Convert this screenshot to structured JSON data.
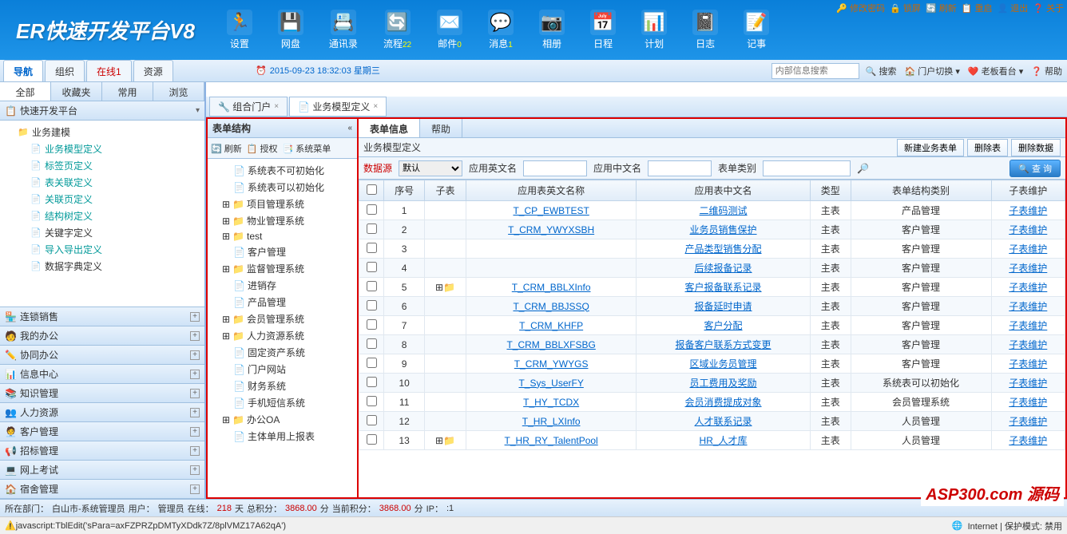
{
  "logo": "ER快速开发平台V8",
  "top_actions": [
    {
      "icon": "🔑",
      "label": "修改密码"
    },
    {
      "icon": "🔒",
      "label": "锁屏"
    },
    {
      "icon": "🔄",
      "label": "刷新"
    },
    {
      "icon": "📋",
      "label": "重启"
    },
    {
      "icon": "👤",
      "label": "退出"
    },
    {
      "icon": "❓",
      "label": "关于"
    }
  ],
  "toolbar": [
    {
      "icon": "🏃",
      "label": "设置",
      "count": ""
    },
    {
      "icon": "💾",
      "label": "网盘",
      "count": ""
    },
    {
      "icon": "📇",
      "label": "通讯录",
      "count": ""
    },
    {
      "icon": "🔄",
      "label": "流程",
      "count": "22"
    },
    {
      "icon": "✉️",
      "label": "邮件",
      "count": "0"
    },
    {
      "icon": "💬",
      "label": "消息",
      "count": "1"
    },
    {
      "icon": "📷",
      "label": "相册",
      "count": ""
    },
    {
      "icon": "📅",
      "label": "日程",
      "count": ""
    },
    {
      "icon": "📊",
      "label": "计划",
      "count": ""
    },
    {
      "icon": "📓",
      "label": "日志",
      "count": ""
    },
    {
      "icon": "📝",
      "label": "记事",
      "count": ""
    }
  ],
  "nav_tabs": [
    {
      "label": "导航",
      "active": true
    },
    {
      "label": "组织"
    },
    {
      "label": "在线1",
      "red": true
    },
    {
      "label": "资源"
    }
  ],
  "clock": "2015-09-23 18:32:03 星期三",
  "search_placeholder": "内部信息搜索",
  "sub_btns": [
    {
      "icon": "🔍",
      "label": "搜索"
    },
    {
      "icon": "🏠",
      "label": "门户切换",
      "dd": true
    },
    {
      "icon": "❤️",
      "label": "老板看台",
      "dd": true
    },
    {
      "icon": "❓",
      "label": "帮助"
    }
  ],
  "side_tabs": [
    "全部",
    "收藏夹",
    "常用",
    "浏览"
  ],
  "side_header": "快速开发平台",
  "tree": [
    {
      "d": 0,
      "ico": "📁",
      "label": "业务建模",
      "exp": true
    },
    {
      "d": 1,
      "ico": "📄",
      "label": "业务模型定义",
      "teal": true
    },
    {
      "d": 1,
      "ico": "📄",
      "label": "标签页定义",
      "teal": true
    },
    {
      "d": 1,
      "ico": "📄",
      "label": "表关联定义",
      "teal": true
    },
    {
      "d": 1,
      "ico": "📄",
      "label": "关联页定义",
      "teal": true
    },
    {
      "d": 1,
      "ico": "📄",
      "label": "结构树定义",
      "teal": true
    },
    {
      "d": 1,
      "ico": "📄",
      "label": "关键字定义"
    },
    {
      "d": 1,
      "ico": "📄",
      "label": "导入导出定义",
      "teal": true
    },
    {
      "d": 1,
      "ico": "📄",
      "label": "数据字典定义"
    }
  ],
  "accordion": [
    {
      "icon": "🏪",
      "label": "连锁销售"
    },
    {
      "icon": "🧑",
      "label": "我的办公"
    },
    {
      "icon": "✏️",
      "label": "协同办公"
    },
    {
      "icon": "📊",
      "label": "信息中心"
    },
    {
      "icon": "📚",
      "label": "知识管理"
    },
    {
      "icon": "👥",
      "label": "人力资源"
    },
    {
      "icon": "🧑‍💼",
      "label": "客户管理"
    },
    {
      "icon": "📢",
      "label": "招标管理"
    },
    {
      "icon": "💻",
      "label": "网上考试"
    },
    {
      "icon": "🏠",
      "label": "宿舍管理"
    }
  ],
  "content_tabs": [
    {
      "icon": "🔧",
      "label": "组合门户"
    },
    {
      "icon": "📄",
      "label": "业务模型定义",
      "active": true
    }
  ],
  "tree_panel": {
    "title": "表单结构",
    "toolbar": [
      {
        "icon": "🔄",
        "label": "刷新"
      },
      {
        "icon": "📋",
        "label": "授权"
      },
      {
        "icon": "📑",
        "label": "系统菜单"
      }
    ],
    "nodes": [
      {
        "d": 1,
        "ico": "📄",
        "label": "系统表不可初始化"
      },
      {
        "d": 1,
        "ico": "📄",
        "label": "系统表可以初始化"
      },
      {
        "d": 0,
        "ico": "📁",
        "label": "项目管理系统"
      },
      {
        "d": 0,
        "ico": "📁",
        "label": "物业管理系统"
      },
      {
        "d": 0,
        "ico": "📁",
        "label": "test"
      },
      {
        "d": 1,
        "ico": "📄",
        "label": "客户管理"
      },
      {
        "d": 0,
        "ico": "📁",
        "label": "监督管理系统"
      },
      {
        "d": 1,
        "ico": "📄",
        "label": "进销存"
      },
      {
        "d": 1,
        "ico": "📄",
        "label": "产品管理"
      },
      {
        "d": 0,
        "ico": "📁",
        "label": "会员管理系统"
      },
      {
        "d": 0,
        "ico": "📁",
        "label": "人力资源系统"
      },
      {
        "d": 1,
        "ico": "📄",
        "label": "固定资产系统"
      },
      {
        "d": 1,
        "ico": "📄",
        "label": "门户网站"
      },
      {
        "d": 1,
        "ico": "📄",
        "label": "财务系统"
      },
      {
        "d": 1,
        "ico": "📄",
        "label": "手机短信系统"
      },
      {
        "d": 0,
        "ico": "📁",
        "label": "办公OA"
      },
      {
        "d": 1,
        "ico": "📄",
        "label": "主体单用上报表"
      }
    ]
  },
  "data_panel": {
    "tabs": [
      "表单信息",
      "帮助"
    ],
    "title": "业务模型定义",
    "btns": [
      "新建业务表单",
      "删除表",
      "删除数据"
    ],
    "filter": {
      "ds_label": "数据源",
      "ds_value": "默认",
      "en_label": "应用英文名",
      "cn_label": "应用中文名",
      "type_label": "表单类别",
      "search": "查 询"
    },
    "cols": [
      "",
      "序号",
      "子表",
      "应用表英文名称",
      "应用表中文名",
      "类型",
      "表单结构类别",
      "子表维护"
    ],
    "rows": [
      {
        "n": 1,
        "sub": "",
        "en": "T_CP_EWBTEST",
        "cn": "二维码测试",
        "type": "主表",
        "cat": "产品管理",
        "m": "子表维护"
      },
      {
        "n": 2,
        "sub": "",
        "en": "T_CRM_YWYXSBH",
        "cn": "业务员销售保护",
        "type": "主表",
        "cat": "客户管理",
        "m": "子表维护"
      },
      {
        "n": 3,
        "sub": "",
        "en": "",
        "cn": "产品类型销售分配",
        "type": "主表",
        "cat": "客户管理",
        "m": "子表维护"
      },
      {
        "n": 4,
        "sub": "",
        "en": "",
        "cn": "后续报备记录",
        "type": "主表",
        "cat": "客户管理",
        "m": "子表维护"
      },
      {
        "n": 5,
        "sub": "⊞📁",
        "en": "T_CRM_BBLXInfo",
        "cn": "客户报备联系记录",
        "type": "主表",
        "cat": "客户管理",
        "m": "子表维护"
      },
      {
        "n": 6,
        "sub": "",
        "en": "T_CRM_BBJSSQ",
        "cn": "报备延时申请",
        "type": "主表",
        "cat": "客户管理",
        "m": "子表维护"
      },
      {
        "n": 7,
        "sub": "",
        "en": "T_CRM_KHFP",
        "cn": "客户分配",
        "type": "主表",
        "cat": "客户管理",
        "m": "子表维护"
      },
      {
        "n": 8,
        "sub": "",
        "en": "T_CRM_BBLXFSBG",
        "cn": "报备客户联系方式变更",
        "type": "主表",
        "cat": "客户管理",
        "m": "子表维护"
      },
      {
        "n": 9,
        "sub": "",
        "en": "T_CRM_YWYGS",
        "cn": "区域业务员管理",
        "type": "主表",
        "cat": "客户管理",
        "m": "子表维护"
      },
      {
        "n": 10,
        "sub": "",
        "en": "T_Sys_UserFY",
        "cn": "员工费用及奖励",
        "type": "主表",
        "cat": "系统表可以初始化",
        "m": "子表维护"
      },
      {
        "n": 11,
        "sub": "",
        "en": "T_HY_TCDX",
        "cn": "会员消费提成对象",
        "type": "主表",
        "cat": "会员管理系统",
        "m": "子表维护"
      },
      {
        "n": 12,
        "sub": "",
        "en": "T_HR_LXInfo",
        "cn": "人才联系记录",
        "type": "主表",
        "cat": "人员管理",
        "m": "子表维护"
      },
      {
        "n": 13,
        "sub": "⊞📁",
        "en": "T_HR_RY_TalentPool",
        "cn": "HR_人才库",
        "type": "主表",
        "cat": "人员管理",
        "m": "子表维护"
      }
    ]
  },
  "status": {
    "dept_label": "所在部门：",
    "dept": "白山市-系统管理员",
    "user_label": "用户：",
    "user": "管理员",
    "online_label": "在线：",
    "online": "218",
    "online_unit": "天",
    "total_label": "总积分：",
    "total": "3868.00",
    "unit": "分",
    "current_label": "当前积分：",
    "current": "3868.00",
    "ip_label": "IP：",
    "ip": ":1"
  },
  "js_status": "javascript:TblEdit('sPara=axFZPRZpDMTyXDdk7Z/8plVMZ17A62qA')",
  "ie": {
    "label": "Internet | 保护模式: 禁用"
  },
  "watermark": "ASP300.com 源码"
}
